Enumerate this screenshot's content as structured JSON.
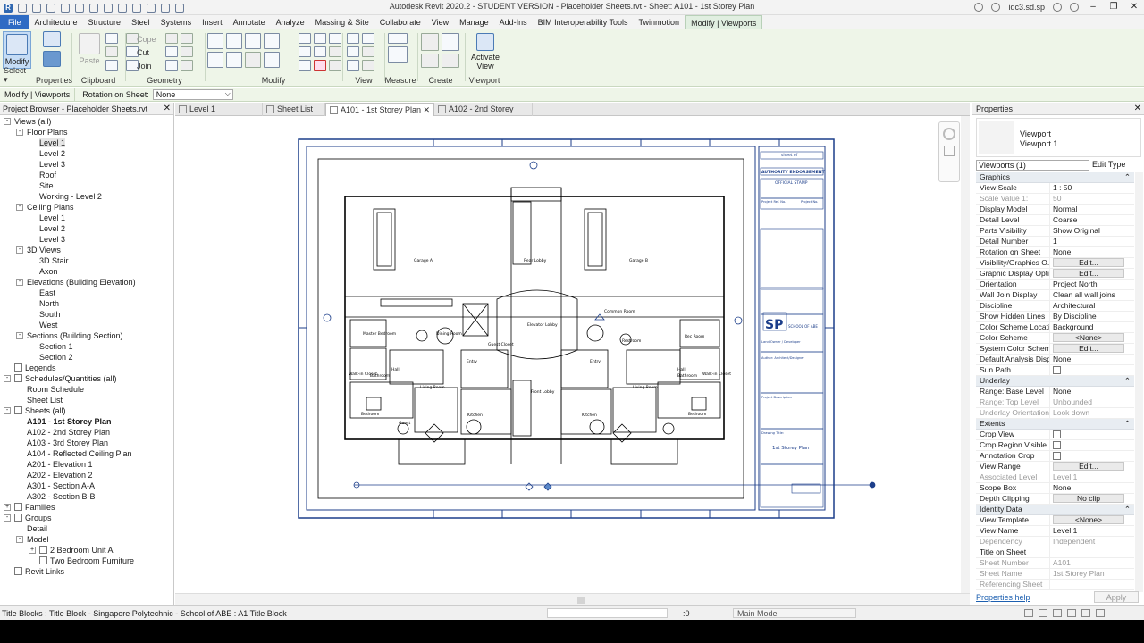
{
  "titlebar": {
    "title": "Autodesk Revit 2020.2 - STUDENT VERSION - Placeholder Sheets.rvt - Sheet: A101 - 1st Storey Plan",
    "user": "idc3.sd.sp",
    "help": "?"
  },
  "menu": [
    "File",
    "Architecture",
    "Structure",
    "Steel",
    "Systems",
    "Insert",
    "Annotate",
    "Analyze",
    "Massing & Site",
    "Collaborate",
    "View",
    "Manage",
    "Add-Ins",
    "BIM Interoperability Tools",
    "Twinmotion",
    "Modify | Viewports"
  ],
  "ribbon": {
    "modify_label": "Modify",
    "cope_label": "Cope",
    "cut_label": "Cut",
    "join_label": "Join",
    "paste_label": "Paste",
    "activate_view_label": "Activate View",
    "panels": {
      "select": "Select",
      "properties": "Properties",
      "clipboard": "Clipboard",
      "geometry": "Geometry",
      "modify": "Modify",
      "view": "View",
      "measure": "Measure",
      "create": "Create",
      "viewport": "Viewport"
    }
  },
  "optionsbar": {
    "context": "Modify | Viewports",
    "rotation_label": "Rotation on Sheet:",
    "rotation_value": "None"
  },
  "project_browser": {
    "title": "Project Browser - Placeholder Sheets.rvt",
    "nodes": [
      {
        "t": "Views (all)",
        "d": 0,
        "tog": "-"
      },
      {
        "t": "Floor Plans",
        "d": 1,
        "tog": "-"
      },
      {
        "t": "Level 1",
        "d": 2,
        "sel": true
      },
      {
        "t": "Level 2",
        "d": 2
      },
      {
        "t": "Level 3",
        "d": 2
      },
      {
        "t": "Roof",
        "d": 2
      },
      {
        "t": "Site",
        "d": 2
      },
      {
        "t": "Working - Level 2",
        "d": 2
      },
      {
        "t": "Ceiling Plans",
        "d": 1,
        "tog": "-"
      },
      {
        "t": "Level 1",
        "d": 2
      },
      {
        "t": "Level 2",
        "d": 2
      },
      {
        "t": "Level 3",
        "d": 2
      },
      {
        "t": "3D Views",
        "d": 1,
        "tog": "-"
      },
      {
        "t": "3D Stair",
        "d": 2
      },
      {
        "t": "Axon",
        "d": 2
      },
      {
        "t": "Elevations (Building Elevation)",
        "d": 1,
        "tog": "-"
      },
      {
        "t": "East",
        "d": 2
      },
      {
        "t": "North",
        "d": 2
      },
      {
        "t": "South",
        "d": 2
      },
      {
        "t": "West",
        "d": 2
      },
      {
        "t": "Sections (Building Section)",
        "d": 1,
        "tog": "-"
      },
      {
        "t": "Section 1",
        "d": 2
      },
      {
        "t": "Section 2",
        "d": 2
      },
      {
        "t": "Legends",
        "d": 0,
        "ico": true
      },
      {
        "t": "Schedules/Quantities (all)",
        "d": 0,
        "tog": "-",
        "ico": true
      },
      {
        "t": "Room Schedule",
        "d": 1
      },
      {
        "t": "Sheet List",
        "d": 1
      },
      {
        "t": "Sheets (all)",
        "d": 0,
        "tog": "-",
        "ico": true
      },
      {
        "t": "A101 - 1st Storey Plan",
        "d": 1,
        "bold": true
      },
      {
        "t": "A102 - 2nd Storey Plan",
        "d": 1
      },
      {
        "t": "A103 - 3rd Storey Plan",
        "d": 1
      },
      {
        "t": "A104 - Reflected Ceiling Plan",
        "d": 1
      },
      {
        "t": "A201 - Elevation 1",
        "d": 1
      },
      {
        "t": "A202 - Elevation 2",
        "d": 1
      },
      {
        "t": "A301 - Section A-A",
        "d": 1
      },
      {
        "t": "A302 - Section B-B",
        "d": 1
      },
      {
        "t": "Families",
        "d": 0,
        "tog": "+",
        "ico": true
      },
      {
        "t": "Groups",
        "d": 0,
        "tog": "-",
        "ico": true
      },
      {
        "t": "Detail",
        "d": 1
      },
      {
        "t": "Model",
        "d": 1,
        "tog": "-"
      },
      {
        "t": "2 Bedroom Unit A",
        "d": 2,
        "tog": "+",
        "ico": true
      },
      {
        "t": "Two Bedroom Furniture",
        "d": 2,
        "ico": true
      },
      {
        "t": "Revit Links",
        "d": 0,
        "ico": true
      }
    ]
  },
  "doc_tabs": [
    {
      "label": "Level 1",
      "active": false
    },
    {
      "label": "Sheet List",
      "active": false
    },
    {
      "label": "A101 - 1st Storey Plan",
      "active": true
    },
    {
      "label": "A102 - 2nd Storey Plan",
      "active": false
    }
  ],
  "sheet": {
    "rooms": [
      "Garage A",
      "Garage B",
      "Rear Lobby",
      "Elevator Lobby",
      "Common Room",
      "Rec Room",
      "Restroom",
      "Master Bedroom",
      "Walk-in Closet",
      "Bedroom",
      "Bedroom",
      "Walk-in Closet",
      "Living Room",
      "Living Room",
      "Dining Room",
      "Kitchen",
      "Kitchen",
      "Entry",
      "Entry",
      "Front Lobby",
      "Hall",
      "Hall",
      "Bathroom",
      "Bathroom",
      "Guest Closet",
      "Guest"
    ],
    "title_block": {
      "sheet_of": "sheet of",
      "authority": "AUTHORITY ENDORSEMENT",
      "stamp": "OFFICIAL STAMP",
      "project_ref": "Project Ref. No.",
      "project_no": "Project No.",
      "logo": "SP",
      "school": "SCHOOL OF ABE",
      "land_owner": "Land Owner / Developer",
      "author": "Author: Architect/Designer",
      "project_desc": "Project Description",
      "drawing_title": "Drawing Title:",
      "sheet_name": "1st Storey Plan"
    }
  },
  "properties": {
    "title": "Properties",
    "type_family": "Viewport",
    "type_name": "Viewport 1",
    "instance_selector": "Viewports (1)",
    "edit_type": "Edit Type",
    "rows": [
      {
        "g": "Graphics"
      },
      {
        "k": "View Scale",
        "v": "1 : 50"
      },
      {
        "k": "Scale Value    1:",
        "v": "50",
        "dim": true
      },
      {
        "k": "Display Model",
        "v": "Normal"
      },
      {
        "k": "Detail Level",
        "v": "Coarse"
      },
      {
        "k": "Parts Visibility",
        "v": "Show Original"
      },
      {
        "k": "Detail Number",
        "v": "1"
      },
      {
        "k": "Rotation on Sheet",
        "v": "None"
      },
      {
        "k": "Visibility/Graphics O...",
        "v": "Edit...",
        "btn": true
      },
      {
        "k": "Graphic Display Opti...",
        "v": "Edit...",
        "btn": true
      },
      {
        "k": "Orientation",
        "v": "Project North"
      },
      {
        "k": "Wall Join Display",
        "v": "Clean all wall joins"
      },
      {
        "k": "Discipline",
        "v": "Architectural"
      },
      {
        "k": "Show Hidden Lines",
        "v": "By Discipline"
      },
      {
        "k": "Color Scheme Locati...",
        "v": "Background"
      },
      {
        "k": "Color Scheme",
        "v": "<None>",
        "btn": true
      },
      {
        "k": "System Color Schemes",
        "v": "Edit...",
        "btn": true
      },
      {
        "k": "Default Analysis Disp...",
        "v": "None"
      },
      {
        "k": "Sun Path",
        "chk": true
      },
      {
        "g": "Underlay"
      },
      {
        "k": "Range: Base Level",
        "v": "None"
      },
      {
        "k": "Range: Top Level",
        "v": "Unbounded",
        "dim": true
      },
      {
        "k": "Underlay Orientation",
        "v": "Look down",
        "dim": true
      },
      {
        "g": "Extents"
      },
      {
        "k": "Crop View",
        "chk": true
      },
      {
        "k": "Crop Region Visible",
        "chk": true
      },
      {
        "k": "Annotation Crop",
        "chk": true
      },
      {
        "k": "View Range",
        "v": "Edit...",
        "btn": true
      },
      {
        "k": "Associated Level",
        "v": "Level 1",
        "dim": true
      },
      {
        "k": "Scope Box",
        "v": "None"
      },
      {
        "k": "Depth Clipping",
        "v": "No clip",
        "btn": true
      },
      {
        "g": "Identity Data"
      },
      {
        "k": "View Template",
        "v": "<None>",
        "btn": true
      },
      {
        "k": "View Name",
        "v": "Level 1"
      },
      {
        "k": "Dependency",
        "v": "Independent",
        "dim": true
      },
      {
        "k": "Title on Sheet",
        "v": ""
      },
      {
        "k": "Sheet Number",
        "v": "A101",
        "dim": true
      },
      {
        "k": "Sheet Name",
        "v": "1st Storey Plan",
        "dim": true
      },
      {
        "k": "Referencing Sheet",
        "v": "",
        "dim": true
      }
    ],
    "help": "Properties help",
    "apply": "Apply"
  },
  "status": {
    "text": "Title Blocks : Title Block - Singapore Polytechnic - School of ABE : A1 Title Block",
    "zero": ":0",
    "model": "Main Model"
  }
}
